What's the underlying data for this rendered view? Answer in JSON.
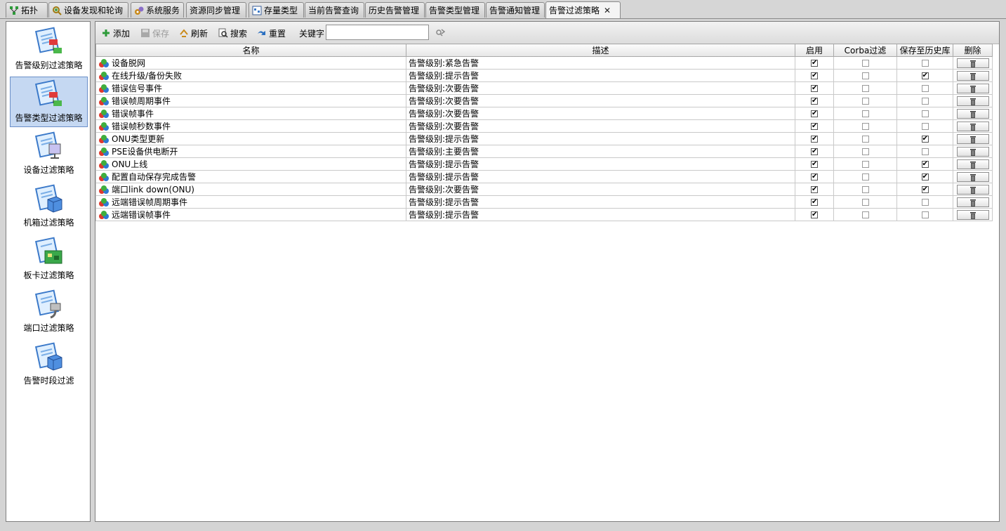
{
  "tabs": [
    {
      "label": "拓扑",
      "icon": "topology-icon"
    },
    {
      "label": "设备发现和轮询",
      "icon": "device-discovery-icon"
    },
    {
      "label": "系统服务",
      "icon": "system-service-icon"
    },
    {
      "label": "资源同步管理",
      "icon": ""
    },
    {
      "label": "存量类型",
      "icon": "inventory-type-icon"
    },
    {
      "label": "当前告警查询",
      "icon": ""
    },
    {
      "label": "历史告警管理",
      "icon": ""
    },
    {
      "label": "告警类型管理",
      "icon": ""
    },
    {
      "label": "告警通知管理",
      "icon": ""
    },
    {
      "label": "告警过滤策略",
      "icon": "",
      "active": true,
      "close": "✕"
    }
  ],
  "sidebar": {
    "items": [
      {
        "label": "告警级别过滤策略",
        "icon": "alarm-level-filter-icon"
      },
      {
        "label": "告警类型过滤策略",
        "icon": "alarm-type-filter-icon",
        "selected": true
      },
      {
        "label": "设备过滤策略",
        "icon": "device-filter-icon"
      },
      {
        "label": "机箱过滤策略",
        "icon": "chassis-filter-icon"
      },
      {
        "label": "板卡过滤策略",
        "icon": "board-filter-icon"
      },
      {
        "label": "端口过滤策略",
        "icon": "port-filter-icon"
      },
      {
        "label": "告警时段过滤",
        "icon": "alarm-period-filter-icon"
      }
    ]
  },
  "toolbar": {
    "add_label": "添加",
    "save_label": "保存",
    "refresh_label": "刷新",
    "search_label": "搜索",
    "reset_label": "重置",
    "keyword_label": "关键字",
    "keyword_value": ""
  },
  "table": {
    "columns": [
      "名称",
      "描述",
      "启用",
      "Corba过滤",
      "保存至历史库",
      "删除"
    ],
    "rows": [
      {
        "name": "设备脱网",
        "desc": "告警级别:紧急告警",
        "enabled": true,
        "corba": false,
        "history": false
      },
      {
        "name": "在线升级/备份失败",
        "desc": "告警级别:提示告警",
        "enabled": true,
        "corba": false,
        "history": true
      },
      {
        "name": "错误信号事件",
        "desc": "告警级别:次要告警",
        "enabled": true,
        "corba": false,
        "history": false
      },
      {
        "name": "错误帧周期事件",
        "desc": "告警级别:次要告警",
        "enabled": true,
        "corba": false,
        "history": false
      },
      {
        "name": "错误帧事件",
        "desc": "告警级别:次要告警",
        "enabled": true,
        "corba": false,
        "history": false
      },
      {
        "name": "错误帧秒数事件",
        "desc": "告警级别:次要告警",
        "enabled": true,
        "corba": false,
        "history": false
      },
      {
        "name": "ONU类型更新",
        "desc": "告警级别:提示告警",
        "enabled": true,
        "corba": false,
        "history": true
      },
      {
        "name": "PSE设备供电断开",
        "desc": "告警级别:主要告警",
        "enabled": true,
        "corba": false,
        "history": false
      },
      {
        "name": "ONU上线",
        "desc": "告警级别:提示告警",
        "enabled": true,
        "corba": false,
        "history": true
      },
      {
        "name": "配置自动保存完成告警",
        "desc": "告警级别:提示告警",
        "enabled": true,
        "corba": false,
        "history": true
      },
      {
        "name": "端口link down(ONU)",
        "desc": "告警级别:次要告警",
        "enabled": true,
        "corba": false,
        "history": true
      },
      {
        "name": "远端错误帧周期事件",
        "desc": "告警级别:提示告警",
        "enabled": true,
        "corba": false,
        "history": false
      },
      {
        "name": "远端错误帧事件",
        "desc": "告警级别:提示告警",
        "enabled": true,
        "corba": false,
        "history": false
      }
    ]
  },
  "colors": {
    "selection_bg": "#c5d8f2",
    "selection_border": "#6b8fc8",
    "panel_bg": "#d4d4d4"
  }
}
